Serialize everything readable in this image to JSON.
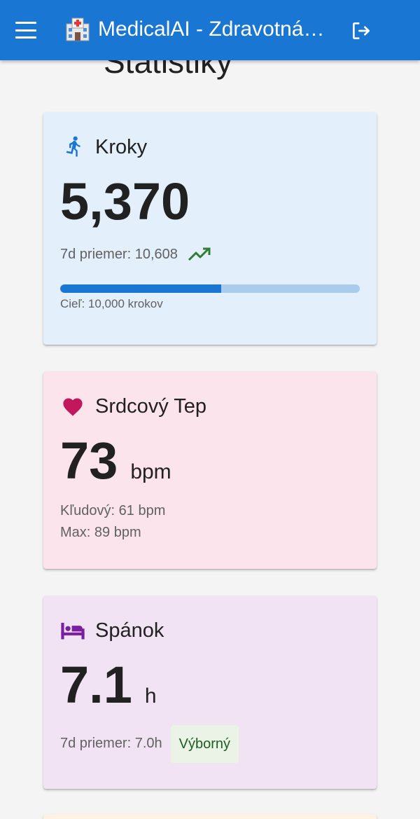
{
  "app": {
    "title": "MedicalAI - Zdravotná…",
    "logo_icon": "hospital-icon",
    "menu_icon": "hamburger-menu-icon",
    "logout_icon": "logout-icon",
    "brand_color": "#1976d2"
  },
  "page": {
    "heading": "Štatistiky"
  },
  "steps": {
    "title": "Kroky",
    "icon": "running-person-icon",
    "value": "5,370",
    "avg_label": "7d priemer: 10,608",
    "trend_icon": "trending-up-icon",
    "progress": 0.537,
    "goal_label": "Cieľ: 10,000 krokov",
    "color": "#e3f0fb"
  },
  "heart": {
    "title": "Srdcový Tep",
    "icon": "heart-icon",
    "value": "73",
    "unit": "bpm",
    "resting_label": "Kľudový: 61 bpm",
    "max_label": "Max: 89 bpm",
    "color": "#fbe4ec"
  },
  "sleep": {
    "title": "Spánok",
    "icon": "bed-icon",
    "value": "7.1",
    "unit": "h",
    "avg_label": "7d priemer: 7.0h",
    "quality_badge": "Výborný",
    "color": "#f2e3f4"
  }
}
